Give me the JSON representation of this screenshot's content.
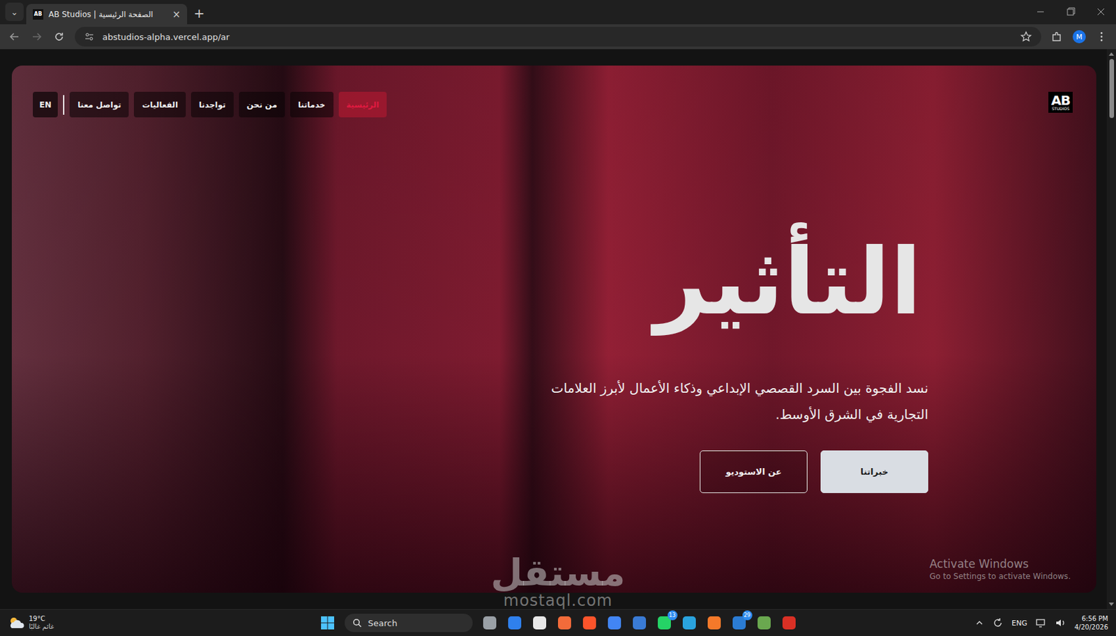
{
  "browser": {
    "tab_search": "⌄",
    "tabs": [
      {
        "favicon": "AB",
        "title": "AB Studios | الصفحة الرئيسية",
        "close": "×",
        "selected": true
      }
    ],
    "new_tab": "+",
    "address": "abstudios-alpha.vercel.app/ar",
    "profile": "M"
  },
  "page": {
    "logo": {
      "main": "AB",
      "sub": "STUDIOS"
    },
    "nav": [
      {
        "label": "الرئيسية",
        "selected": true
      },
      {
        "label": "خدماتنا",
        "selected": false
      },
      {
        "label": "من نحن",
        "selected": false
      },
      {
        "label": "تواجدنا",
        "selected": false
      },
      {
        "label": "الفعاليات",
        "selected": false
      },
      {
        "label": "تواصل معنا",
        "selected": false
      }
    ],
    "language": "EN",
    "hero": {
      "title": "التأثير",
      "subtitle_lines": [
        "نسد الفجوة بين السرد القصصي الإبداعي وذكاء الأعمال لأبرز العلامات",
        "التجارية في الشرق الأوسط."
      ],
      "buttons": [
        {
          "label": "خبراتنا",
          "kind": "filled"
        },
        {
          "label": "عن الاستوديو",
          "kind": "outline"
        }
      ]
    }
  },
  "overlays": {
    "activation": {
      "title": "Activate Windows",
      "hint": "Go to Settings to activate Windows."
    },
    "watermark": {
      "arabic": "مستقل",
      "latin": "mostaql.com"
    }
  },
  "taskbar": {
    "weather": {
      "temp": "19°C",
      "condition": "غائم غالبًا"
    },
    "search": "Search",
    "apps": [
      {
        "name": "task-view",
        "color": "#9aa0a6"
      },
      {
        "name": "vscode",
        "color": "#2f80ed"
      },
      {
        "name": "app-white",
        "color": "#e8e8e8"
      },
      {
        "name": "app-orange",
        "color": "#f26b3a"
      },
      {
        "name": "brave",
        "color": "#fb542b"
      },
      {
        "name": "chrome",
        "color": "#4285f4"
      },
      {
        "name": "store",
        "color": "#3a7bd5"
      },
      {
        "name": "whatsapp",
        "color": "#25d366",
        "badge": "13"
      },
      {
        "name": "telegram",
        "color": "#2aa3de"
      },
      {
        "name": "blender",
        "color": "#f5792a"
      },
      {
        "name": "mail",
        "color": "#2b7cd3",
        "badge": "29"
      },
      {
        "name": "lambda",
        "color": "#6aa84f"
      },
      {
        "name": "app-red",
        "color": "#d93025"
      }
    ],
    "tray": {
      "language": "ENG",
      "time": "6:56 PM",
      "date": "4/20/2026"
    }
  }
}
